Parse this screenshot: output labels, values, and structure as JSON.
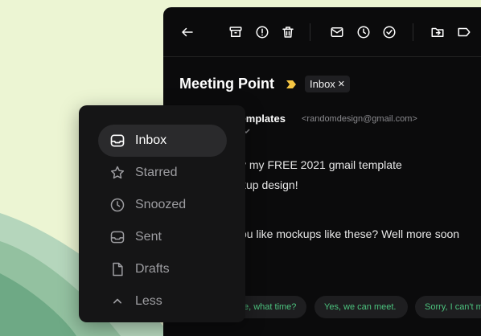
{
  "colors": {
    "background": "#ecf5d3",
    "window": "#0b0b0c",
    "sidebar": "#151516",
    "accent_tag": "#f5c542",
    "reply_text": "#4cc37e"
  },
  "toolbar": {
    "icons": [
      "back-arrow-icon",
      "archive-icon",
      "report-spam-icon",
      "trash-icon",
      "mail-icon",
      "clock-icon",
      "check-circle-icon",
      "move-to-folder-icon",
      "label-icon"
    ]
  },
  "email": {
    "subject": "Meeting Point",
    "label_chip": "Inbox",
    "label_chip_close": "✕",
    "sender_name": "ytemplates",
    "sender_email": "<randomdesign@gmail.com>",
    "body_lines": [
      "y my FREE 2021 gmail template",
      "kup design!",
      "ou like mockups like these? Well more soon"
    ],
    "smart_replies": [
      "e, what time?",
      "Yes, we can meet.",
      "Sorry, I can't m"
    ]
  },
  "sidebar": {
    "items": [
      {
        "label": "Inbox",
        "icon": "inbox-icon",
        "active": true
      },
      {
        "label": "Starred",
        "icon": "star-icon",
        "active": false
      },
      {
        "label": "Snoozed",
        "icon": "clock-icon",
        "active": false
      },
      {
        "label": "Sent",
        "icon": "sent-tray-icon",
        "active": false
      },
      {
        "label": "Drafts",
        "icon": "file-icon",
        "active": false
      },
      {
        "label": "Less",
        "icon": "chevron-up-icon",
        "active": false
      }
    ]
  }
}
